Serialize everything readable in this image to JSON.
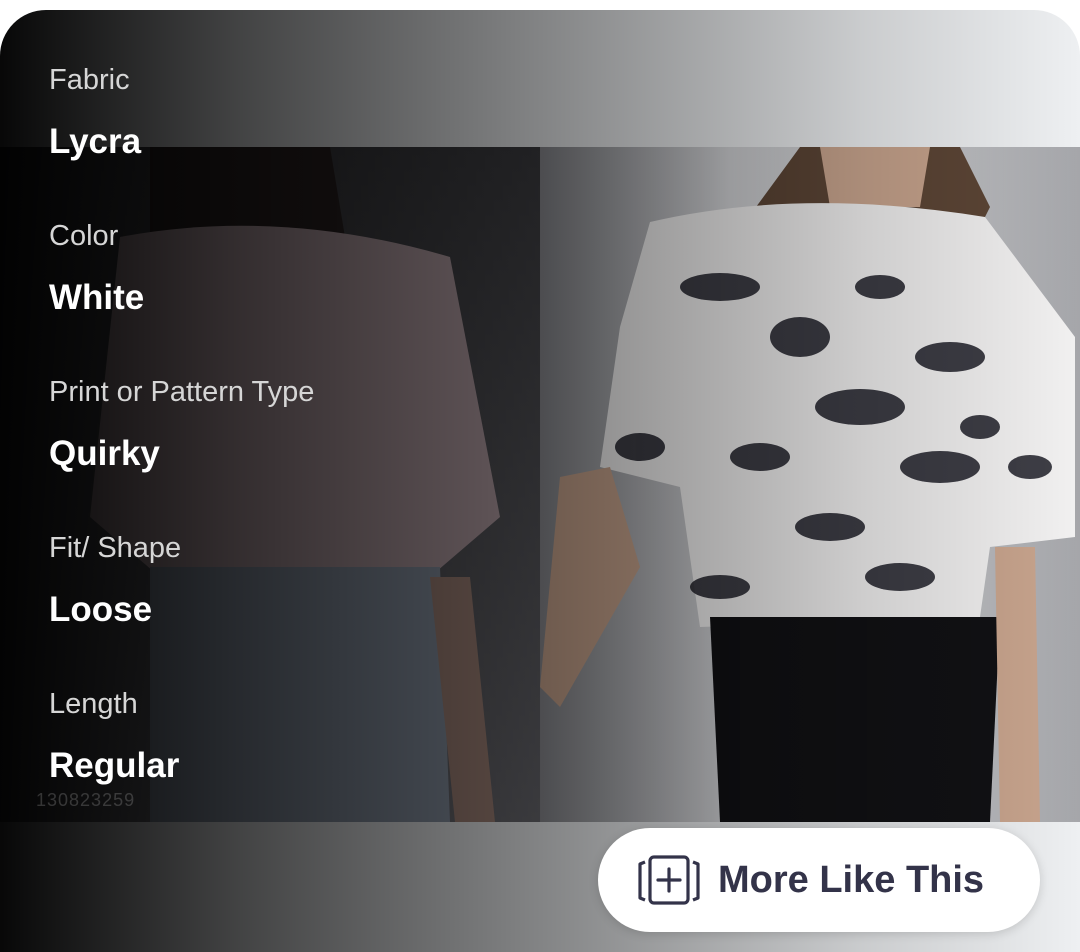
{
  "attributes": [
    {
      "label": "Fabric",
      "value": "Lycra"
    },
    {
      "label": "Color",
      "value": "White"
    },
    {
      "label": "Print or Pattern Type",
      "value": "Quirky"
    },
    {
      "label": "Fit/ Shape",
      "value": "Loose"
    },
    {
      "label": "Length",
      "value": "Regular"
    }
  ],
  "watermark": "130823259",
  "more_button": {
    "label": "More Like This",
    "icon": "add-collection-icon"
  },
  "colors": {
    "overlay": "#000000",
    "button_bg": "#ffffff",
    "button_text": "#333349"
  }
}
